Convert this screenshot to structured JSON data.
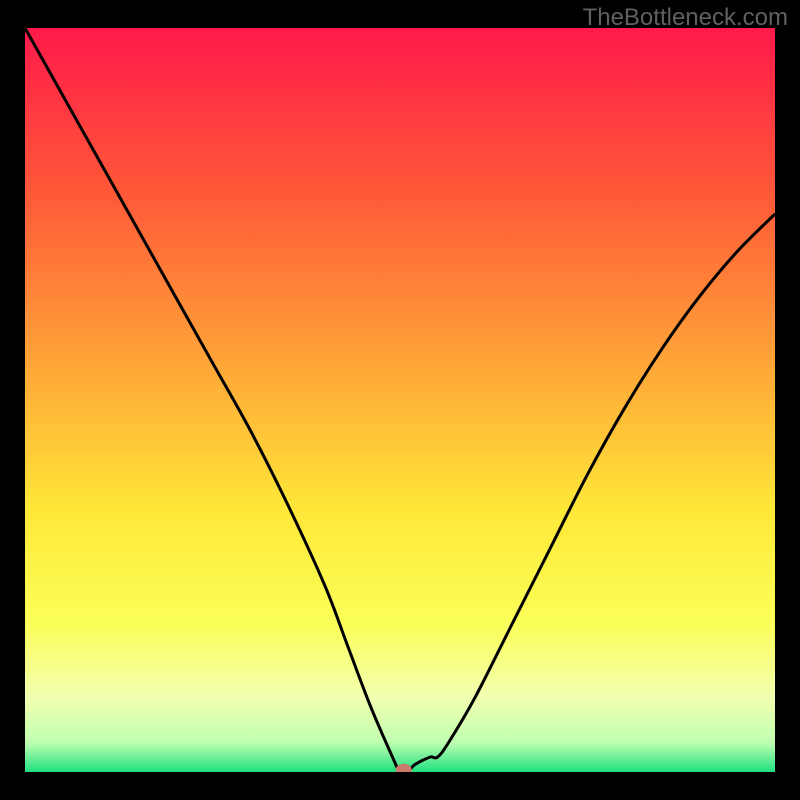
{
  "watermark": "TheBottleneck.com",
  "chart_data": {
    "type": "line",
    "title": "",
    "xlabel": "",
    "ylabel": "",
    "xlim": [
      0,
      100
    ],
    "ylim": [
      0,
      100
    ],
    "gradient_stops": [
      {
        "offset": 0,
        "color": "#ff1a4a"
      },
      {
        "offset": 22,
        "color": "#ff5838"
      },
      {
        "offset": 45,
        "color": "#ffa538"
      },
      {
        "offset": 65,
        "color": "#ffe838"
      },
      {
        "offset": 80,
        "color": "#fbff58"
      },
      {
        "offset": 90,
        "color": "#f2ffb0"
      },
      {
        "offset": 96,
        "color": "#c0ffb0"
      },
      {
        "offset": 100,
        "color": "#20e080"
      }
    ],
    "series": [
      {
        "name": "bottleneck-curve",
        "type": "line",
        "x": [
          0,
          5,
          10,
          15,
          20,
          25,
          30,
          35,
          40,
          43,
          46,
          49,
          50,
          51,
          52,
          54,
          55,
          56.5,
          60,
          65,
          70,
          75,
          80,
          85,
          90,
          95,
          100
        ],
        "y": [
          100,
          91,
          82,
          73,
          64,
          55,
          46,
          36,
          25,
          17,
          9,
          2,
          0,
          0,
          1,
          2,
          2,
          4,
          10,
          20,
          30,
          40,
          49,
          57,
          64,
          70,
          75
        ]
      }
    ],
    "marker": {
      "x": 50.5,
      "y": 0.3,
      "color": "#c97a6a",
      "rx": 8,
      "ry": 6
    }
  }
}
